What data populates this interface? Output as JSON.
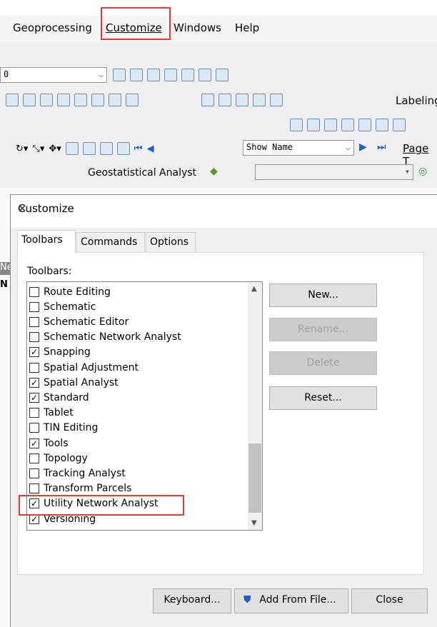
{
  "menu": {
    "items": [
      "Geoprocessing",
      "Customize",
      "Windows",
      "Help"
    ],
    "highlighted": "Customize"
  },
  "toolbar": {
    "scale_value": "0",
    "page_field": "Show Name",
    "labeling": "Labeling",
    "page_text": "Page T",
    "geostat": "Geostatistical Analyst"
  },
  "background": {
    "fragment1": "Ne",
    "fragment2": "N"
  },
  "dialog": {
    "title": "Customize",
    "tabs": [
      "Toolbars",
      "Commands",
      "Options"
    ],
    "active_tab": "Toolbars",
    "list_label": "Toolbars:",
    "items": [
      {
        "label": "Route Editing",
        "checked": false
      },
      {
        "label": "Schematic",
        "checked": false
      },
      {
        "label": "Schematic Editor",
        "checked": false
      },
      {
        "label": "Schematic Network Analyst",
        "checked": false
      },
      {
        "label": "Snapping",
        "checked": true
      },
      {
        "label": "Spatial Adjustment",
        "checked": false
      },
      {
        "label": "Spatial Analyst",
        "checked": true
      },
      {
        "label": "Standard",
        "checked": true
      },
      {
        "label": "Tablet",
        "checked": false
      },
      {
        "label": "TIN Editing",
        "checked": false
      },
      {
        "label": "Tools",
        "checked": true
      },
      {
        "label": "Topology",
        "checked": false
      },
      {
        "label": "Tracking Analyst",
        "checked": false
      },
      {
        "label": "Transform Parcels",
        "checked": false
      },
      {
        "label": "Utility Network Analyst",
        "checked": true,
        "highlighted": true
      },
      {
        "label": "Versioning",
        "checked": true
      }
    ],
    "buttons": {
      "new": "New...",
      "rename": "Rename...",
      "delete": "Delete",
      "reset": "Reset..."
    },
    "footer": {
      "keyboard": "Keyboard...",
      "add_from_file": "Add From File...",
      "close": "Close"
    }
  },
  "colors": {
    "highlight_box": "#e53935"
  }
}
